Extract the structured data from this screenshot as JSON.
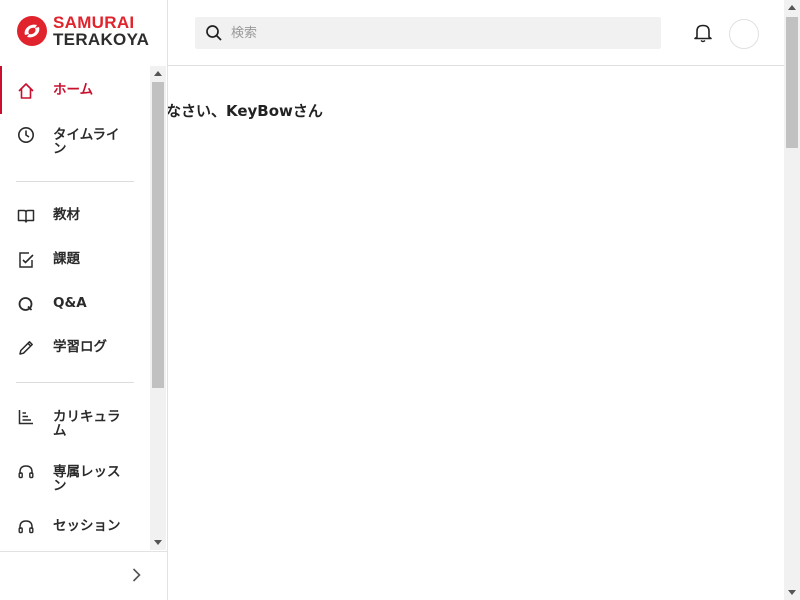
{
  "app": {
    "logo_line1": "SAMURAI",
    "logo_line2": "TERAKOYA",
    "brand_color": "#e0232c",
    "accent_color": "#c8102e"
  },
  "header": {
    "search_placeholder": "検索",
    "notification_icon": "bell-icon",
    "avatar_icon": "avatar"
  },
  "sidebar": {
    "items": [
      {
        "label": "ホーム",
        "icon": "home-icon",
        "active": true
      },
      {
        "label": "タイムライン",
        "icon": "clock-icon"
      },
      {
        "label": "教材",
        "icon": "book-icon"
      },
      {
        "label": "課題",
        "icon": "assignment-check-icon"
      },
      {
        "label": "Q&A",
        "icon": "qa-icon"
      },
      {
        "label": "学習ログ",
        "icon": "pencil-icon"
      },
      {
        "label": "カリキュラム",
        "icon": "curriculum-chart-icon"
      },
      {
        "label": "専属レッスン",
        "icon": "headset-icon"
      },
      {
        "label": "セッション",
        "icon": "headset-icon"
      }
    ],
    "expand_icon": "chevron-right-icon"
  },
  "main": {
    "greeting": "なさい、KeyBowさん"
  }
}
